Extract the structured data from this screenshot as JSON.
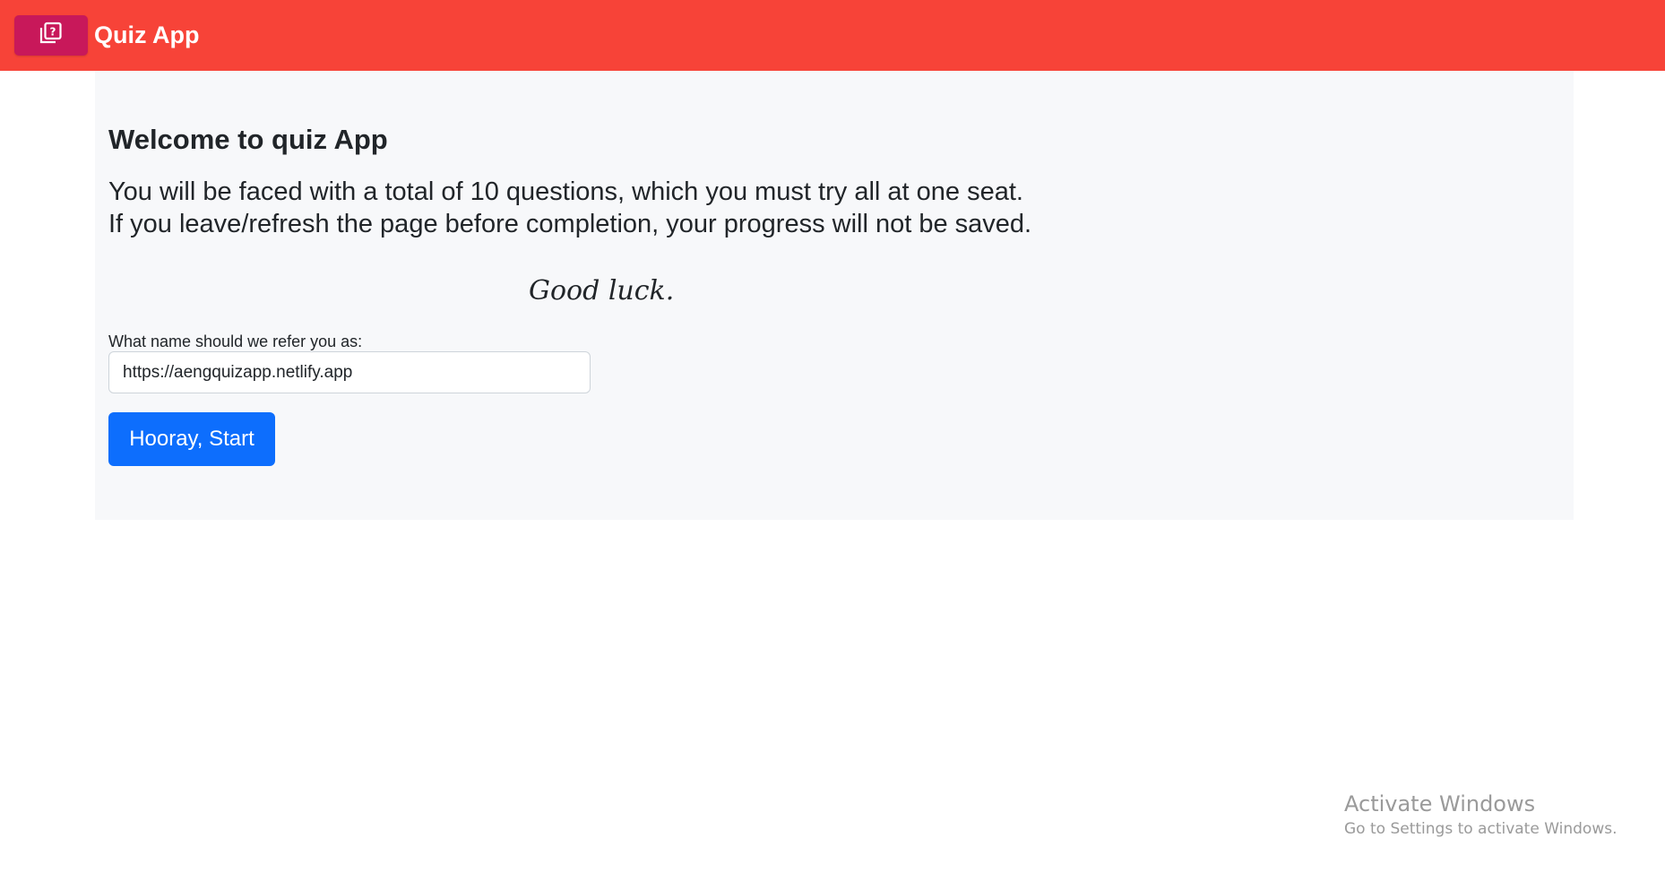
{
  "header": {
    "logo_icon": "quiz-question-icon",
    "title": "Quiz App",
    "colors": {
      "navbar": "#f74338",
      "logo_button": "#c8185a"
    }
  },
  "main": {
    "heading": "Welcome to quiz App",
    "intro_line1": "You will be faced with a total of 10 questions, which you must try all at one seat.",
    "intro_line2": "If you leave/refresh the page before completion, your progress will not be saved.",
    "good_luck": "Good luck.",
    "name_label": "What name should we refer you as:",
    "name_value": "https://aengquizapp.netlify.app",
    "start_button": "Hooray, Start",
    "colors": {
      "panel": "#f7f8fa",
      "primary": "#0d6efd"
    }
  },
  "watermark": {
    "title": "Activate Windows",
    "subtitle": "Go to Settings to activate Windows."
  }
}
